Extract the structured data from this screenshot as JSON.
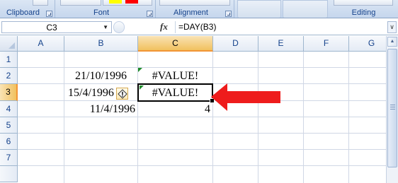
{
  "ribbon": {
    "groups": [
      {
        "label": "Clipboard"
      },
      {
        "label": "Font"
      },
      {
        "label": "Alignment"
      },
      {
        "label": "Editing"
      }
    ],
    "font_color_swatches": [
      "#ffff00",
      "#ff0000"
    ]
  },
  "formula_bar": {
    "name_box": "C3",
    "fx_label": "fx",
    "formula": "=DAY(B3)"
  },
  "grid": {
    "columns": [
      "A",
      "B",
      "C",
      "D",
      "E",
      "F",
      "G"
    ],
    "rows": [
      "1",
      "2",
      "3",
      "4",
      "5",
      "6",
      "7"
    ],
    "active_cell": "C3",
    "cells": {
      "B2": "21/10/1996",
      "B3": "15/4/1996",
      "B4": "11/4/1996",
      "C2": "#VALUE!",
      "C3": "#VALUE!",
      "C4": "4"
    }
  },
  "colors": {
    "annotation_arrow": "#ee1c1c",
    "error_indicator": "#1f8c2b",
    "active_header": "#f1c15f",
    "ribbon_label": "#15428b"
  },
  "icons": {
    "error_smart_tag": "warning-diamond-icon",
    "name_box_dropdown": "chevron-down-icon",
    "formula_bar_expand": "double-chevron-down-icon"
  }
}
